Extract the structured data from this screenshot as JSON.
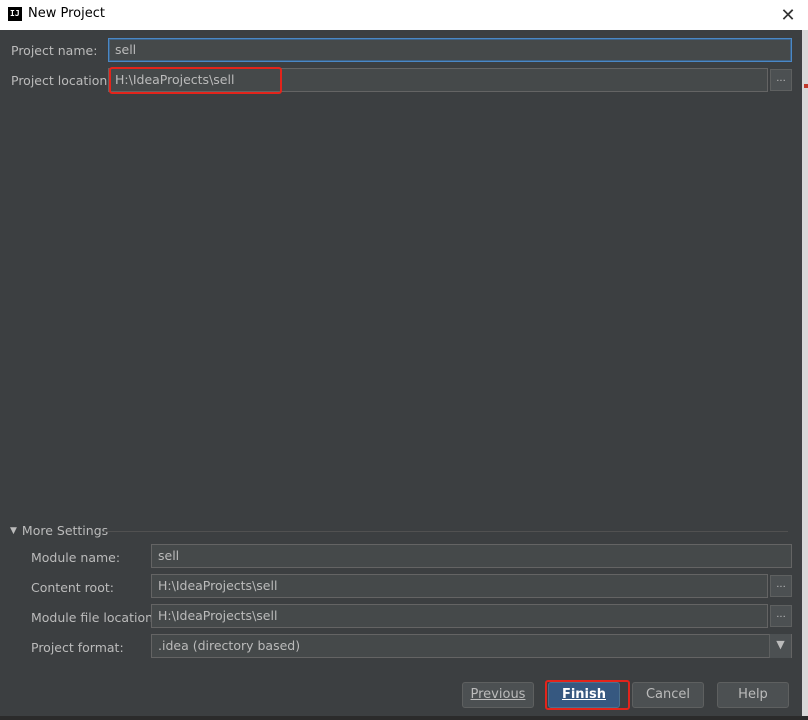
{
  "window": {
    "title": "New Project",
    "icon_text": "IJ"
  },
  "project": {
    "name_label": "Project name:",
    "name_value": "sell",
    "location_label": "Project location:",
    "location_value": "H:\\IdeaProjects\\sell",
    "browse_label": "..."
  },
  "more_settings": {
    "label": "More Settings",
    "module_name_label": "Module name:",
    "module_name_value": "sell",
    "content_root_label": "Content root:",
    "content_root_value": "H:\\IdeaProjects\\sell",
    "module_file_label": "Module file location:",
    "module_file_value": "H:\\IdeaProjects\\sell",
    "format_label": "Project format:",
    "format_value": ".idea (directory based)"
  },
  "buttons": {
    "previous": "Previous",
    "finish": "Finish",
    "cancel": "Cancel",
    "help": "Help"
  },
  "colors": {
    "background": "#3c3f41",
    "field": "#45494a",
    "primary_button": "#365880",
    "highlight": "#e3241b",
    "focus": "#4a88c7"
  },
  "icons": {
    "app": "intellij-icon",
    "close": "close-icon",
    "expand": "triangle-down-icon",
    "dropdown": "chevron-down-icon"
  }
}
